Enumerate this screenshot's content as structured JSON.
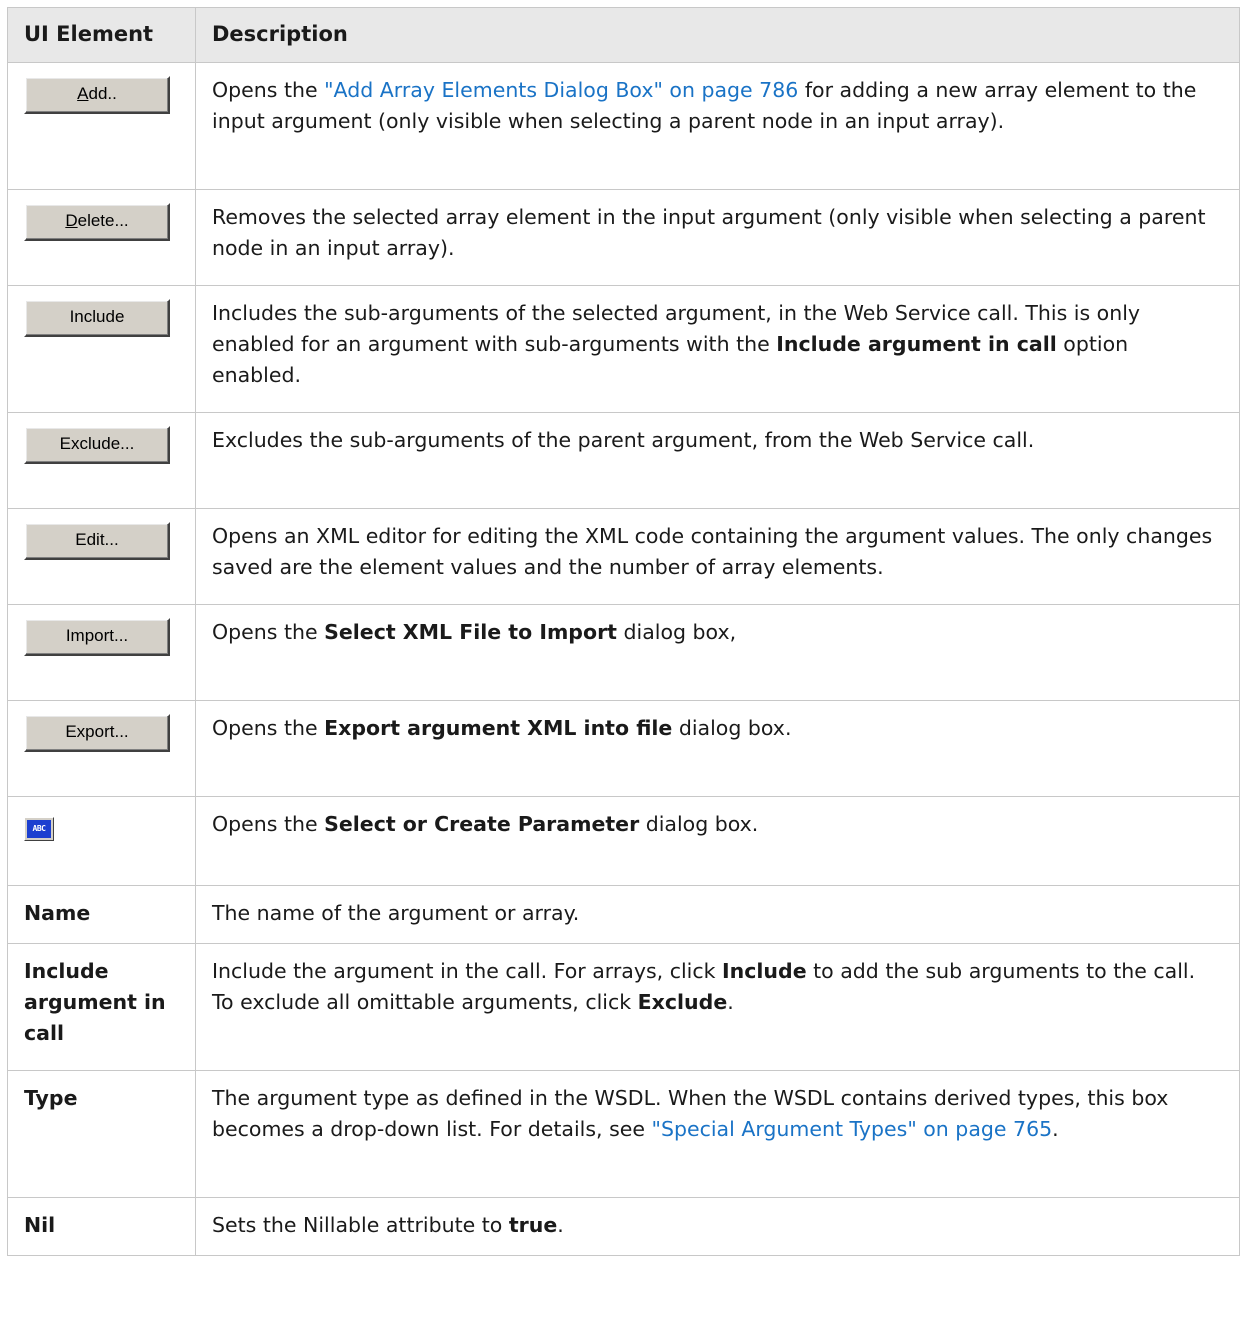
{
  "header": {
    "col_ui": "UI Element",
    "col_desc": "Description"
  },
  "rows": [
    {
      "element": "Add..",
      "desc_pre": "Opens the ",
      "desc_link": "\"Add Array Elements Dialog Box\" on page 786",
      "desc_post": " for adding a new array element to the input argument (only visible when selecting a parent node in an input array)."
    },
    {
      "element": "Delete...",
      "desc": "Removes the selected array element in the input argument (only visible when selecting a parent node in an input array)."
    },
    {
      "element": "Include",
      "desc_pre": "Includes the sub-arguments of the selected argument, in the Web Service call. This is only enabled for an argument with sub-arguments with the ",
      "desc_bold": "Include argument in call",
      "desc_post": " option enabled."
    },
    {
      "element": "Exclude...",
      "desc": "Excludes the sub-arguments of the parent argument, from the Web Service call."
    },
    {
      "element": "Edit...",
      "desc": "Opens an XML editor for editing the XML code containing the argument values. The only changes saved are the element values and the number of array elements."
    },
    {
      "element": "Import...",
      "desc_pre": "Opens the ",
      "desc_bold": "Select XML File to Import",
      "desc_post": " dialog box,"
    },
    {
      "element": "Export...",
      "desc_pre": "Opens the ",
      "desc_bold": "Export argument XML into file",
      "desc_post": " dialog box."
    },
    {
      "element_icon": "abc-parameter-icon",
      "element_icon_text": "ABC",
      "desc_pre": "Opens the ",
      "desc_bold": "Select or Create Parameter",
      "desc_post": " dialog box."
    },
    {
      "element": "Name",
      "desc": "The name of the argument or array."
    },
    {
      "element": "Include argument in call",
      "desc_pre": "Include the argument in the call. For arrays, click ",
      "desc_bold": "Include",
      "desc_mid": " to add the sub arguments to the call. To exclude all omittable arguments, click ",
      "desc_bold2": "Exclude",
      "desc_post": "."
    },
    {
      "element": "Type",
      "desc_pre": "The argument type as defined in the WSDL. When the WSDL contains derived types, this box becomes a drop-down list. For details, see ",
      "desc_link": "\"Special Argument Types\" on page 765",
      "desc_post": "."
    },
    {
      "element": "Nil",
      "desc_pre": "Sets the Nillable attribute to ",
      "desc_bold": "true",
      "desc_post": "."
    }
  ],
  "colors": {
    "header_bg": "#e8e8e8",
    "link": "#1a73c6",
    "border": "#c8c8c8",
    "button_face": "#d4d0c8"
  }
}
